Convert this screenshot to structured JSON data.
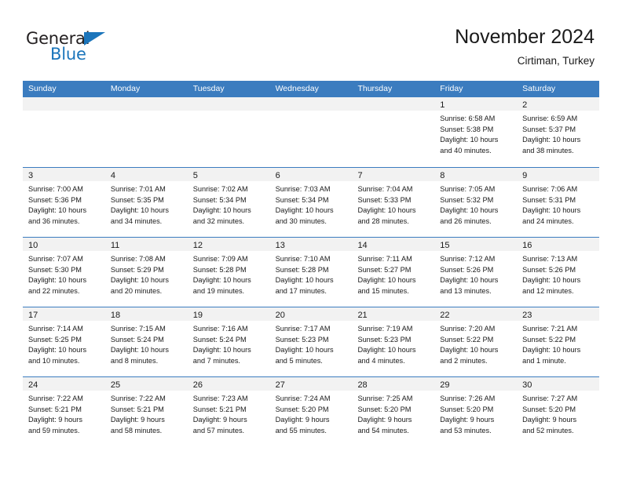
{
  "brand": {
    "name_part1": "General",
    "name_part2": "Blue",
    "accent_color": "#1b75bb"
  },
  "header": {
    "title": "November 2024",
    "subtitle": "Cirtiman, Turkey"
  },
  "theme": {
    "header_blue": "#3b7cbf",
    "day_strip_gray": "#f2f2f2",
    "text_color": "#1a1a1a"
  },
  "weekdays": [
    "Sunday",
    "Monday",
    "Tuesday",
    "Wednesday",
    "Thursday",
    "Friday",
    "Saturday"
  ],
  "weeks": [
    [
      {
        "day": "",
        "lines": []
      },
      {
        "day": "",
        "lines": []
      },
      {
        "day": "",
        "lines": []
      },
      {
        "day": "",
        "lines": []
      },
      {
        "day": "",
        "lines": []
      },
      {
        "day": "1",
        "lines": [
          "Sunrise: 6:58 AM",
          "Sunset: 5:38 PM",
          "Daylight: 10 hours",
          "and 40 minutes."
        ]
      },
      {
        "day": "2",
        "lines": [
          "Sunrise: 6:59 AM",
          "Sunset: 5:37 PM",
          "Daylight: 10 hours",
          "and 38 minutes."
        ]
      }
    ],
    [
      {
        "day": "3",
        "lines": [
          "Sunrise: 7:00 AM",
          "Sunset: 5:36 PM",
          "Daylight: 10 hours",
          "and 36 minutes."
        ]
      },
      {
        "day": "4",
        "lines": [
          "Sunrise: 7:01 AM",
          "Sunset: 5:35 PM",
          "Daylight: 10 hours",
          "and 34 minutes."
        ]
      },
      {
        "day": "5",
        "lines": [
          "Sunrise: 7:02 AM",
          "Sunset: 5:34 PM",
          "Daylight: 10 hours",
          "and 32 minutes."
        ]
      },
      {
        "day": "6",
        "lines": [
          "Sunrise: 7:03 AM",
          "Sunset: 5:34 PM",
          "Daylight: 10 hours",
          "and 30 minutes."
        ]
      },
      {
        "day": "7",
        "lines": [
          "Sunrise: 7:04 AM",
          "Sunset: 5:33 PM",
          "Daylight: 10 hours",
          "and 28 minutes."
        ]
      },
      {
        "day": "8",
        "lines": [
          "Sunrise: 7:05 AM",
          "Sunset: 5:32 PM",
          "Daylight: 10 hours",
          "and 26 minutes."
        ]
      },
      {
        "day": "9",
        "lines": [
          "Sunrise: 7:06 AM",
          "Sunset: 5:31 PM",
          "Daylight: 10 hours",
          "and 24 minutes."
        ]
      }
    ],
    [
      {
        "day": "10",
        "lines": [
          "Sunrise: 7:07 AM",
          "Sunset: 5:30 PM",
          "Daylight: 10 hours",
          "and 22 minutes."
        ]
      },
      {
        "day": "11",
        "lines": [
          "Sunrise: 7:08 AM",
          "Sunset: 5:29 PM",
          "Daylight: 10 hours",
          "and 20 minutes."
        ]
      },
      {
        "day": "12",
        "lines": [
          "Sunrise: 7:09 AM",
          "Sunset: 5:28 PM",
          "Daylight: 10 hours",
          "and 19 minutes."
        ]
      },
      {
        "day": "13",
        "lines": [
          "Sunrise: 7:10 AM",
          "Sunset: 5:28 PM",
          "Daylight: 10 hours",
          "and 17 minutes."
        ]
      },
      {
        "day": "14",
        "lines": [
          "Sunrise: 7:11 AM",
          "Sunset: 5:27 PM",
          "Daylight: 10 hours",
          "and 15 minutes."
        ]
      },
      {
        "day": "15",
        "lines": [
          "Sunrise: 7:12 AM",
          "Sunset: 5:26 PM",
          "Daylight: 10 hours",
          "and 13 minutes."
        ]
      },
      {
        "day": "16",
        "lines": [
          "Sunrise: 7:13 AM",
          "Sunset: 5:26 PM",
          "Daylight: 10 hours",
          "and 12 minutes."
        ]
      }
    ],
    [
      {
        "day": "17",
        "lines": [
          "Sunrise: 7:14 AM",
          "Sunset: 5:25 PM",
          "Daylight: 10 hours",
          "and 10 minutes."
        ]
      },
      {
        "day": "18",
        "lines": [
          "Sunrise: 7:15 AM",
          "Sunset: 5:24 PM",
          "Daylight: 10 hours",
          "and 8 minutes."
        ]
      },
      {
        "day": "19",
        "lines": [
          "Sunrise: 7:16 AM",
          "Sunset: 5:24 PM",
          "Daylight: 10 hours",
          "and 7 minutes."
        ]
      },
      {
        "day": "20",
        "lines": [
          "Sunrise: 7:17 AM",
          "Sunset: 5:23 PM",
          "Daylight: 10 hours",
          "and 5 minutes."
        ]
      },
      {
        "day": "21",
        "lines": [
          "Sunrise: 7:19 AM",
          "Sunset: 5:23 PM",
          "Daylight: 10 hours",
          "and 4 minutes."
        ]
      },
      {
        "day": "22",
        "lines": [
          "Sunrise: 7:20 AM",
          "Sunset: 5:22 PM",
          "Daylight: 10 hours",
          "and 2 minutes."
        ]
      },
      {
        "day": "23",
        "lines": [
          "Sunrise: 7:21 AM",
          "Sunset: 5:22 PM",
          "Daylight: 10 hours",
          "and 1 minute."
        ]
      }
    ],
    [
      {
        "day": "24",
        "lines": [
          "Sunrise: 7:22 AM",
          "Sunset: 5:21 PM",
          "Daylight: 9 hours",
          "and 59 minutes."
        ]
      },
      {
        "day": "25",
        "lines": [
          "Sunrise: 7:22 AM",
          "Sunset: 5:21 PM",
          "Daylight: 9 hours",
          "and 58 minutes."
        ]
      },
      {
        "day": "26",
        "lines": [
          "Sunrise: 7:23 AM",
          "Sunset: 5:21 PM",
          "Daylight: 9 hours",
          "and 57 minutes."
        ]
      },
      {
        "day": "27",
        "lines": [
          "Sunrise: 7:24 AM",
          "Sunset: 5:20 PM",
          "Daylight: 9 hours",
          "and 55 minutes."
        ]
      },
      {
        "day": "28",
        "lines": [
          "Sunrise: 7:25 AM",
          "Sunset: 5:20 PM",
          "Daylight: 9 hours",
          "and 54 minutes."
        ]
      },
      {
        "day": "29",
        "lines": [
          "Sunrise: 7:26 AM",
          "Sunset: 5:20 PM",
          "Daylight: 9 hours",
          "and 53 minutes."
        ]
      },
      {
        "day": "30",
        "lines": [
          "Sunrise: 7:27 AM",
          "Sunset: 5:20 PM",
          "Daylight: 9 hours",
          "and 52 minutes."
        ]
      }
    ]
  ]
}
